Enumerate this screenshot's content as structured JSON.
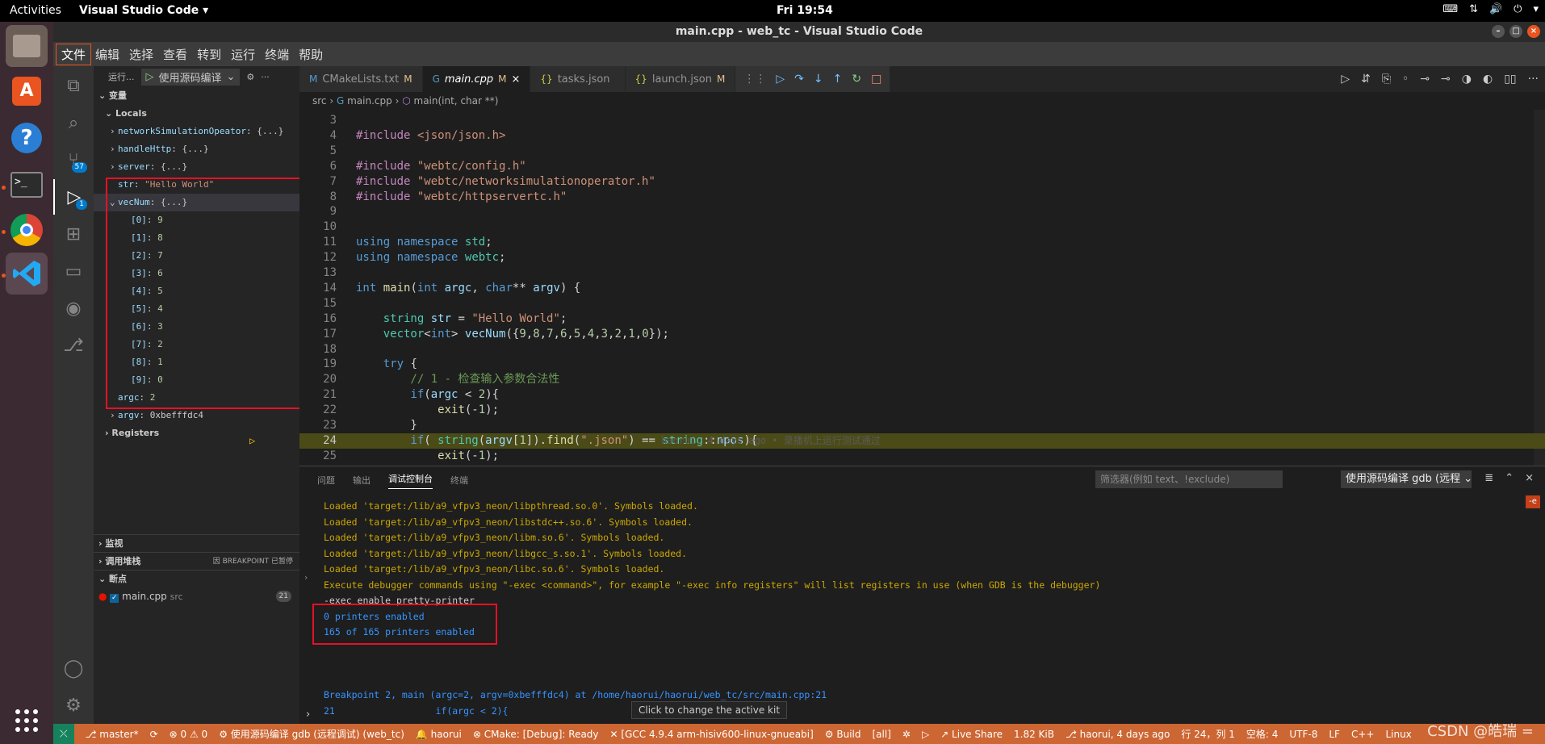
{
  "topbar": {
    "activities": "Activities",
    "app_name": "Visual Studio Code ▾",
    "clock": "Fri 19:54"
  },
  "window": {
    "title": "main.cpp - web_tc - Visual Studio Code"
  },
  "menu": [
    "文件",
    "编辑",
    "选择",
    "查看",
    "转到",
    "运行",
    "终端",
    "帮助"
  ],
  "activity_badges": {
    "source_control": "57",
    "debug": "1"
  },
  "sidebar": {
    "run_label": "运行...",
    "config_name": "使用源码编译",
    "variables_header": "变量",
    "locals_header": "Locals",
    "variables": [
      {
        "name": "networkSimulationOpeator",
        "value": "{...}",
        "indent": 1,
        "arrow": "›"
      },
      {
        "name": "handleHttp",
        "value": "{...}",
        "indent": 1,
        "arrow": "›"
      },
      {
        "name": "server",
        "value": "{...}",
        "indent": 1,
        "arrow": "›"
      },
      {
        "name": "str",
        "value": "\"Hello World\"",
        "indent": 1,
        "arrow": ""
      },
      {
        "name": "vecNum",
        "value": "{...}",
        "indent": 1,
        "arrow": "⌄"
      },
      {
        "name": "[0]",
        "value": "9",
        "indent": 2,
        "arrow": ""
      },
      {
        "name": "[1]",
        "value": "8",
        "indent": 2,
        "arrow": ""
      },
      {
        "name": "[2]",
        "value": "7",
        "indent": 2,
        "arrow": ""
      },
      {
        "name": "[3]",
        "value": "6",
        "indent": 2,
        "arrow": ""
      },
      {
        "name": "[4]",
        "value": "5",
        "indent": 2,
        "arrow": ""
      },
      {
        "name": "[5]",
        "value": "4",
        "indent": 2,
        "arrow": ""
      },
      {
        "name": "[6]",
        "value": "3",
        "indent": 2,
        "arrow": ""
      },
      {
        "name": "[7]",
        "value": "2",
        "indent": 2,
        "arrow": ""
      },
      {
        "name": "[8]",
        "value": "1",
        "indent": 2,
        "arrow": ""
      },
      {
        "name": "[9]",
        "value": "0",
        "indent": 2,
        "arrow": ""
      },
      {
        "name": "argc",
        "value": "2",
        "indent": 1,
        "arrow": ""
      },
      {
        "name": "argv",
        "value": "0xbefffdc4",
        "indent": 1,
        "arrow": "›"
      }
    ],
    "registers_header": "Registers",
    "watch_header": "监视",
    "callstack_header": "调用堆栈",
    "callstack_status": "因 BREAKPOINT 已暂停",
    "breakpoints_header": "断点",
    "breakpoint_file": "main.cpp",
    "breakpoint_dir": "src",
    "breakpoint_line": "21"
  },
  "tabs": [
    {
      "icon": "M",
      "label": "CMakeLists.txt",
      "mod": "M",
      "active": false
    },
    {
      "icon": "C",
      "label": "main.cpp",
      "mod": "M",
      "active": true
    },
    {
      "icon": "{}",
      "label": "tasks.json",
      "mod": "",
      "active": false
    },
    {
      "icon": "{}",
      "label": "launch.json",
      "mod": "M",
      "active": false
    }
  ],
  "breadcrumb": [
    "src",
    "main.cpp",
    "main(int, char **)"
  ],
  "code_lines": [
    {
      "n": "3",
      "t": ""
    },
    {
      "n": "4",
      "t": "#include <json/json.h>"
    },
    {
      "n": "5",
      "t": ""
    },
    {
      "n": "6",
      "t": "#include \"webtc/config.h\""
    },
    {
      "n": "7",
      "t": "#include \"webtc/networksimulationoperator.h\""
    },
    {
      "n": "8",
      "t": "#include \"webtc/httpservertc.h\""
    },
    {
      "n": "9",
      "t": ""
    },
    {
      "n": "10",
      "t": ""
    },
    {
      "n": "11",
      "t": "using namespace std;"
    },
    {
      "n": "12",
      "t": "using namespace webtc;"
    },
    {
      "n": "13",
      "t": ""
    },
    {
      "n": "14",
      "t": "int main(int argc, char** argv) {"
    },
    {
      "n": "15",
      "t": ""
    },
    {
      "n": "16",
      "t": "    string str = \"Hello World\";"
    },
    {
      "n": "17",
      "t": "    vector<int> vecNum({9,8,7,6,5,4,3,2,1,0});"
    },
    {
      "n": "18",
      "t": ""
    },
    {
      "n": "19",
      "t": "    try {"
    },
    {
      "n": "20",
      "t": "        // 1 - 检查输入参数合法性"
    },
    {
      "n": "21",
      "t": "        if(argc < 2){"
    },
    {
      "n": "22",
      "t": "            exit(-1);"
    },
    {
      "n": "23",
      "t": "        }"
    },
    {
      "n": "24",
      "t": "        if( string(argv[1]).find(\".json\") == string::npos){"
    },
    {
      "n": "25",
      "t": "            exit(-1);"
    }
  ],
  "blame": "haorui, 4 days ago • 录播机上运行测试通过",
  "panel": {
    "tabs": [
      "问题",
      "输出",
      "调试控制台",
      "终端"
    ],
    "filter_placeholder": "筛选器(例如 text、!exclude)",
    "session": "使用源码编译 gdb (远程",
    "console_lines": [
      {
        "c": "y",
        "t": "Loaded 'target:/lib/a9_vfpv3_neon/libpthread.so.0'. Symbols loaded."
      },
      {
        "c": "y",
        "t": "Loaded 'target:/lib/a9_vfpv3_neon/libstdc++.so.6'. Symbols loaded."
      },
      {
        "c": "y",
        "t": "Loaded 'target:/lib/a9_vfpv3_neon/libm.so.6'. Symbols loaded."
      },
      {
        "c": "y",
        "t": "Loaded 'target:/lib/a9_vfpv3_neon/libgcc_s.so.1'. Symbols loaded."
      },
      {
        "c": "y",
        "t": "Loaded 'target:/lib/a9_vfpv3_neon/libc.so.6'. Symbols loaded."
      },
      {
        "c": "y",
        "t": "Execute debugger commands using \"-exec <command>\", for example \"-exec info registers\" will list registers in use (when GDB is the debugger)"
      },
      {
        "c": "w",
        "t": "-exec enable pretty-printer"
      },
      {
        "c": "b",
        "t": "0 printers enabled"
      },
      {
        "c": "b",
        "t": "165 of 165 printers enabled"
      },
      {
        "c": "w",
        "t": ""
      },
      {
        "c": "w",
        "t": ""
      },
      {
        "c": "w",
        "t": ""
      },
      {
        "c": "b",
        "t": "Breakpoint 2, main (argc=2, argv=0xbefffdc4) at /home/haorui/haorui/web_tc/src/main.cpp:21"
      },
      {
        "c": "b",
        "t": "21\t\t    if(argc < 2){"
      }
    ]
  },
  "tooltip": "Click to change the active kit",
  "statusbar": [
    "master*",
    "⟳",
    "⊗ 0 ⚠ 0",
    "使用源码编译 gdb (远程调试) (web_tc)",
    "haorui",
    "CMake: [Debug]: Ready",
    "[GCC 4.9.4 arm-hisiv600-linux-gnueabi]",
    "Build",
    "[all]",
    "Live Share",
    "1.82 KiB",
    "haorui, 4 days ago",
    "行 24，列 1",
    "空格: 4",
    "UTF-8",
    "LF",
    "C++",
    "Linux"
  ],
  "watermark": "CSDN @皓瑞 ="
}
